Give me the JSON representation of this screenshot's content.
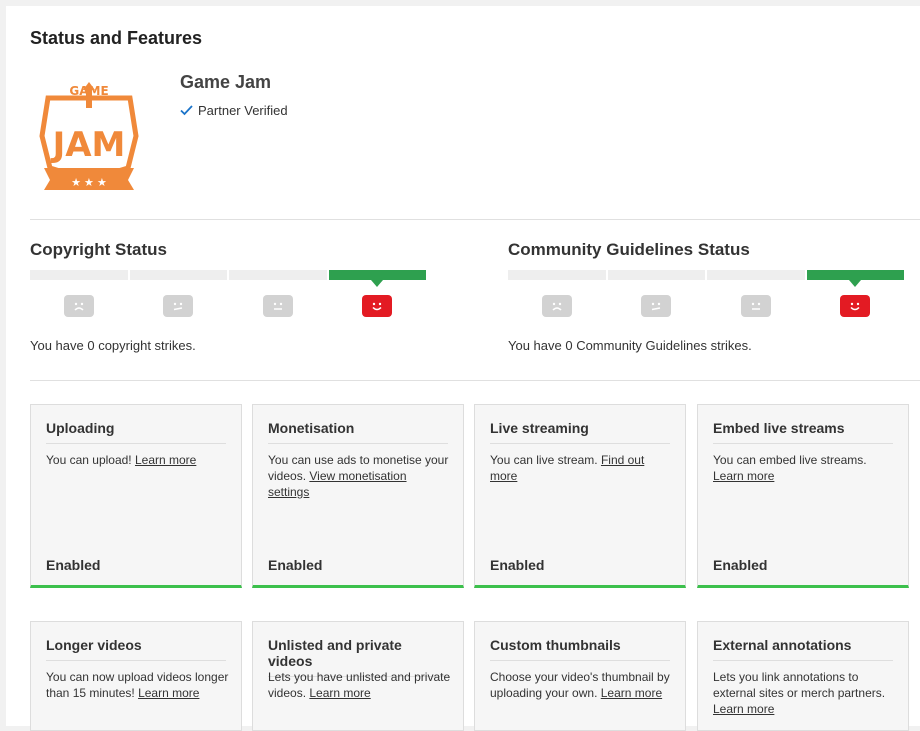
{
  "page": {
    "title": "Status and Features"
  },
  "channel": {
    "name": "Game Jam",
    "verified_label": "Partner Verified",
    "logo": {
      "top_text": "GAME",
      "main_text": "JAM",
      "color": "#f0893a"
    }
  },
  "colors": {
    "active_bar": "#2ea04f",
    "happy_face": "#e31b23",
    "enabled_bar": "#3cc04c"
  },
  "copyright": {
    "title": "Copyright Status",
    "strikes_text": "You have 0 copyright strikes.",
    "faces": [
      "sad-face-icon",
      "unhappy-face-icon",
      "neutral-face-icon",
      "happy-face-icon"
    ]
  },
  "community": {
    "title": "Community Guidelines Status",
    "strikes_text": "You have 0 Community Guidelines strikes.",
    "faces": [
      "sad-face-icon",
      "unhappy-face-icon",
      "neutral-face-icon",
      "happy-face-icon"
    ]
  },
  "features": [
    {
      "title": "Uploading",
      "text": "You can upload! ",
      "link": "Learn more",
      "status": "Enabled"
    },
    {
      "title": "Monetisation",
      "text": "You can use ads to monetise your videos. ",
      "link": "View monetisation settings",
      "status": "Enabled"
    },
    {
      "title": "Live streaming",
      "text": "You can live stream. ",
      "link": "Find out more",
      "status": "Enabled"
    },
    {
      "title": "Embed live streams",
      "text": "You can embed live streams. ",
      "link": "Learn more",
      "status": "Enabled"
    },
    {
      "title": "Longer videos",
      "text": "You can now upload videos longer than 15 minutes! ",
      "link": "Learn more",
      "status": ""
    },
    {
      "title": "Unlisted and private videos",
      "text": "Lets you have unlisted and private videos. ",
      "link": "Learn more",
      "status": ""
    },
    {
      "title": "Custom thumbnails",
      "text": "Choose your video's thumbnail by uploading your own. ",
      "link": "Learn more",
      "status": ""
    },
    {
      "title": "External annotations",
      "text": "Lets you link annotations to external sites or merch partners. ",
      "link": "Learn more",
      "status": ""
    }
  ]
}
